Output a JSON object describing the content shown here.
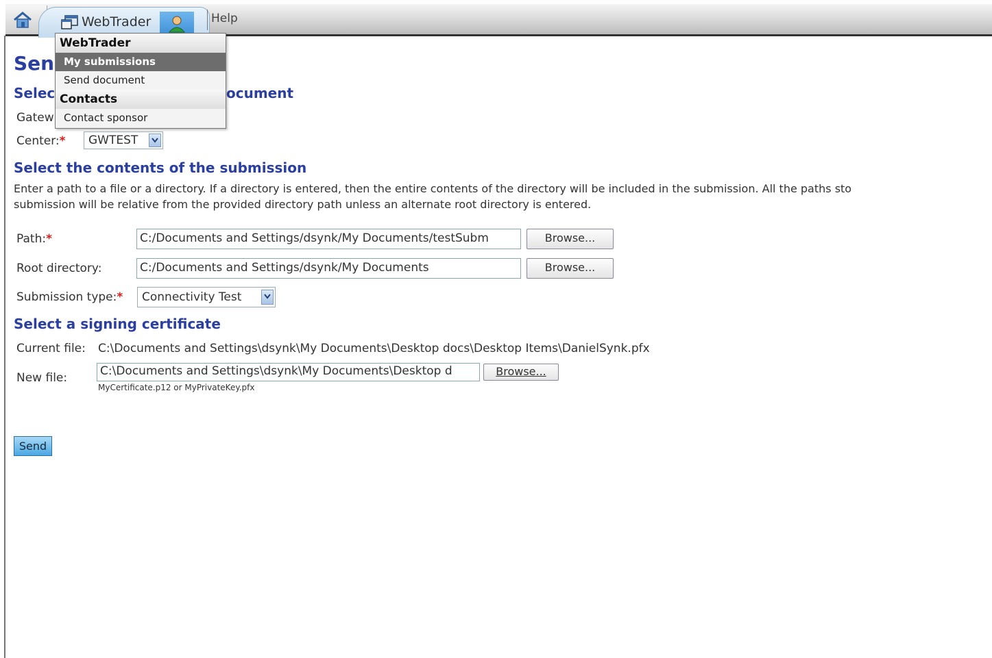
{
  "topbar": {
    "app_tab_label": "WebTrader",
    "help_label": "Help"
  },
  "dropdown": {
    "section1_header": "WebTrader",
    "item_my_submissions": "My submissions",
    "item_send_document": "Send document",
    "section2_header": "Contacts",
    "item_contact_sponsor": "Contact sponsor"
  },
  "page": {
    "title_visible": "Sen",
    "section_select_doc_left": "Select",
    "section_select_doc_right": "ocument",
    "gateway_label_visible": "Gatew",
    "center_label": "Center:",
    "center_value": "GWTEST",
    "section_contents": "Select the contents of the submission",
    "description_line1": "Enter a path to a file or a directory. If a directory is entered, then the entire contents of the directory will be included in the submission. All the paths sto",
    "description_line2": "submission will be relative from the provided directory path unless an alternate root directory is entered.",
    "path_label": "Path:",
    "path_value": "C:/Documents and Settings/dsynk/My Documents/testSubm",
    "root_label": "Root directory:",
    "root_value": "C:/Documents and Settings/dsynk/My Documents",
    "browse_label": "Browse...",
    "submission_type_label": "Submission type:",
    "submission_type_value": "Connectivity Test",
    "section_signing": "Select a signing certificate",
    "current_file_label": "Current file:",
    "current_file_value": "C:\\Documents and Settings\\dsynk\\My Documents\\Desktop docs\\Desktop Items\\DanielSynk.pfx",
    "new_file_label": "New file:",
    "new_file_value": "C:\\Documents and Settings\\dsynk\\My Documents\\Desktop d",
    "new_file_browse": "Browse...",
    "new_file_hint": "MyCertificate.p12 or MyPrivateKey.pfx",
    "send_label": "Send"
  },
  "colors": {
    "heading_blue": "#2b3fa0",
    "required_red": "#e01b1b",
    "menu_selected": "#6d6d6d",
    "send_button": "#4aa8e3"
  },
  "icons": [
    "home-icon",
    "app-window-icon",
    "user-icon",
    "chevron-down-icon"
  ]
}
